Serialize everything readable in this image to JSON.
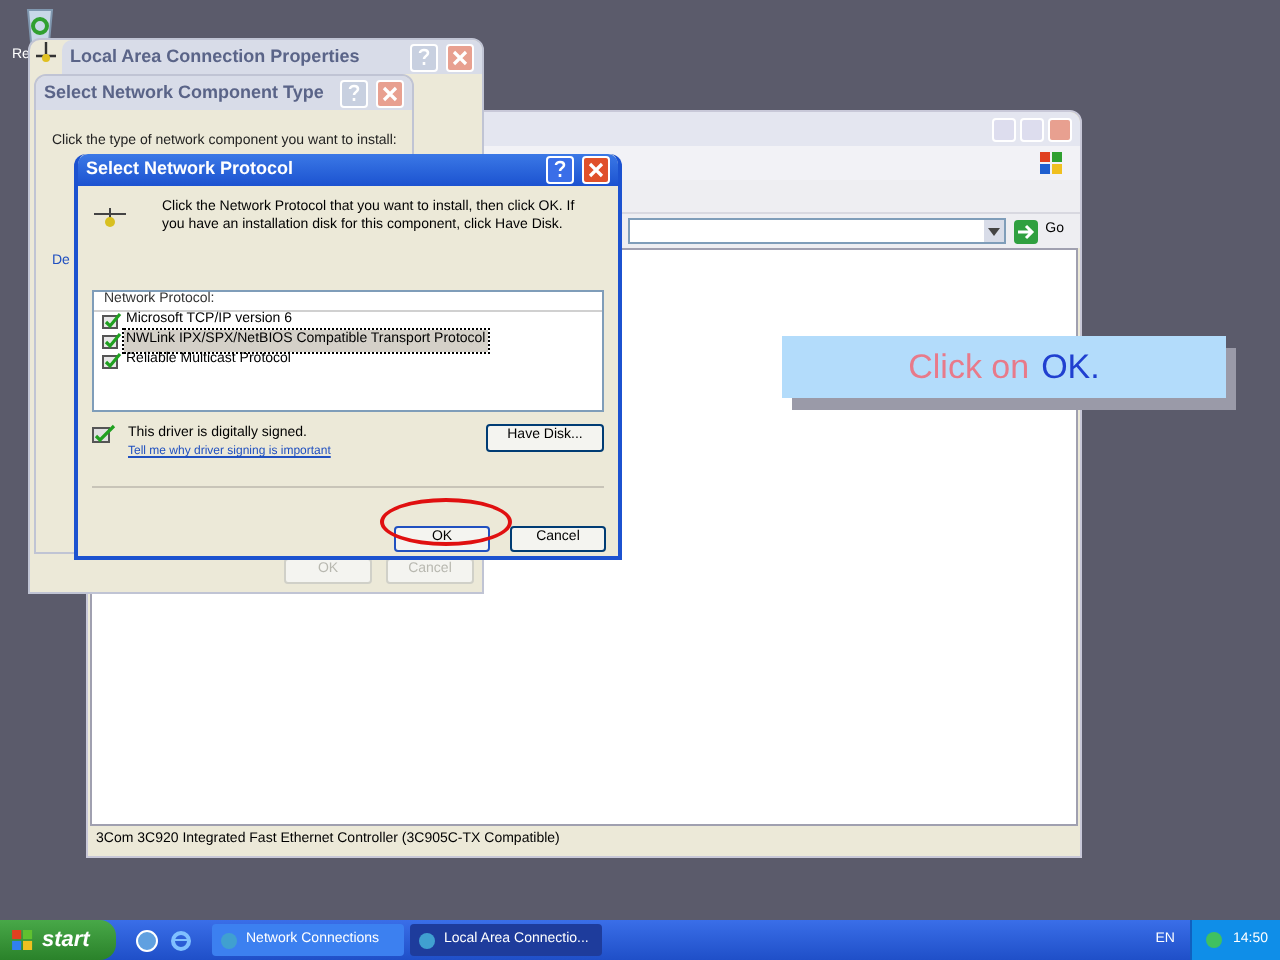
{
  "desktop": {
    "icon_label": "Re"
  },
  "explorer": {
    "status_bar": "3Com 3C920 Integrated Fast Ethernet Controller (3C905C-TX Compatible)",
    "go_label": "Go"
  },
  "properties": {
    "title": "Local Area Connection Properties",
    "fragment": "De",
    "buttons": [
      {
        "label": "OK",
        "disabled": true
      },
      {
        "label": "Cancel",
        "disabled": true
      }
    ]
  },
  "component_type": {
    "title": "Select Network Component Type",
    "instruction": "Click the type of network component you want to install:"
  },
  "protocol_dialog": {
    "title": "Select Network Protocol",
    "instruction": "Click the Network Protocol that you want to install, then click OK. If you have an installation disk for this component, click Have Disk.",
    "list_header": "Network Protocol:",
    "protocols": [
      {
        "label": "Microsoft TCP/IP version 6",
        "selected": false
      },
      {
        "label": "NWLink IPX/SPX/NetBIOS Compatible Transport Protocol",
        "selected": true
      },
      {
        "label": "Reliable Multicast Protocol",
        "selected": false
      }
    ],
    "signed_text": "This driver is digitally signed.",
    "signing_link": "Tell me why driver signing is important",
    "have_disk": "Have Disk...",
    "buttons": [
      {
        "label": "OK",
        "highlighted": true
      },
      {
        "label": "Cancel",
        "highlighted": false
      }
    ]
  },
  "callout": {
    "segments": [
      {
        "text": "Click on",
        "kind": "plain"
      },
      {
        "text": "OK.",
        "kind": "emphasis"
      }
    ]
  },
  "taskbar": {
    "start": "start",
    "tasks": [
      {
        "label": "Network Connections",
        "selected": false
      },
      {
        "label": "Local Area Connectio...",
        "selected": true
      }
    ],
    "language": "EN",
    "clock": "14:50"
  }
}
